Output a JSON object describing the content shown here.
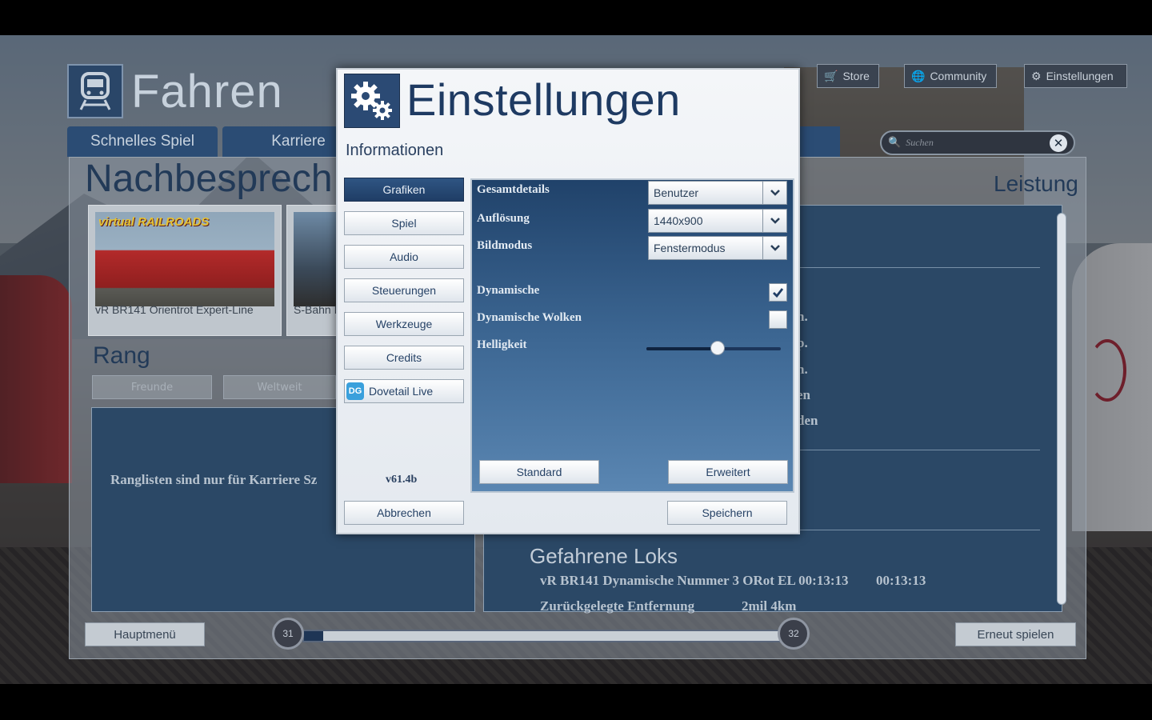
{
  "background": {
    "app_title": "Fahren",
    "top_buttons": {
      "store": "Store",
      "community": "Community",
      "settings": "Einstellungen"
    },
    "tabs": [
      "Schnelles Spiel",
      "Karriere"
    ],
    "search_placeholder": "Suchen",
    "section_title": "Nachbesprech",
    "performance_title": "Leistung",
    "cards": [
      {
        "logo": "virtual RAILROADS",
        "caption": "vR BR141 Orientrot Expert-Line"
      },
      {
        "caption": "S-Bahn I"
      }
    ],
    "rank": {
      "title": "Rang",
      "friends": "Freunde",
      "worldwide": "Weltweit",
      "message": "Ranglisten sind nur für Karriere Sz"
    },
    "performance_fragments": [
      "n.",
      "p.",
      "n.",
      "en",
      "den"
    ],
    "driven_locos": {
      "title": "Gefahrene Loks",
      "row1_name": "vR BR141 Dynamische Nummer 3 ORot EL 00:13:13",
      "row1_time": "00:13:13",
      "row2_label": "Zurückgelegte Entfernung",
      "row2_value": "2mil 4km"
    },
    "footer": {
      "main_menu": "Hauptmenü",
      "replay": "Erneut spielen",
      "level_current": "31",
      "level_next": "32",
      "level_progress": 0.04
    }
  },
  "dialog": {
    "title": "Einstellungen",
    "subtitle": "Informationen",
    "side_buttons": [
      "Grafiken",
      "Spiel",
      "Audio",
      "Steuerungen",
      "Werkzeuge",
      "Credits",
      "Dovetail Live"
    ],
    "active_side": "Grafiken",
    "version": "v61.4b",
    "graphics": {
      "overall_label": "Gesamtdetails",
      "overall_value": "Benutzer",
      "resolution_label": "Auflösung",
      "resolution_value": "1440x900",
      "mode_label": "Bildmodus",
      "mode_value": "Fenstermodus",
      "dynamic_label": "Dynamische",
      "dynamic_checked": true,
      "clouds_label": "Dynamische Wolken",
      "clouds_checked": false,
      "brightness_label": "Helligkeit",
      "brightness_value": 0.53
    },
    "pane_buttons": {
      "standard": "Standard",
      "advanced": "Erweitert"
    },
    "footer": {
      "cancel": "Abbrechen",
      "save": "Speichern"
    }
  },
  "colors": {
    "accent_dark_blue": "#1e3a62",
    "panel_blue": "#2b4866",
    "active_button": "#2f5583"
  }
}
